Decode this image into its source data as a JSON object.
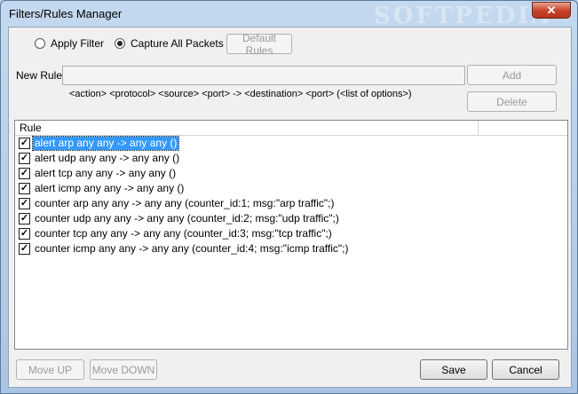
{
  "window": {
    "title": "Filters/Rules Manager",
    "close_glyph": "✕",
    "watermark": "SOFTPEDIA"
  },
  "mode": {
    "apply_filter_label": "Apply Filter",
    "capture_all_label": "Capture All Packets",
    "selected": "capture_all",
    "default_rules_label": "Default Rules"
  },
  "new_rule": {
    "label": "New Rule",
    "value": "",
    "syntax_hint": "<action> <protocol> <source> <port> -> <destination> <port> (<list of options>)",
    "add_label": "Add",
    "delete_label": "Delete"
  },
  "rules_table": {
    "columns": [
      "Rule",
      ""
    ],
    "rows": [
      {
        "text": "alert arp any any -> any any ()",
        "checked": true,
        "selected": true
      },
      {
        "text": "alert udp any any -> any any ()",
        "checked": true,
        "selected": false
      },
      {
        "text": "alert tcp any any -> any any ()",
        "checked": true,
        "selected": false
      },
      {
        "text": "alert icmp any any -> any any ()",
        "checked": true,
        "selected": false
      },
      {
        "text": "counter arp any any -> any any (counter_id:1; msg:\"arp traffic\";)",
        "checked": true,
        "selected": false
      },
      {
        "text": "counter udp any any -> any any (counter_id:2; msg:\"udp traffic\";)",
        "checked": true,
        "selected": false
      },
      {
        "text": "counter tcp any any -> any any (counter_id:3; msg:\"tcp traffic\";)",
        "checked": true,
        "selected": false
      },
      {
        "text": "counter icmp any any -> any any (counter_id:4; msg:\"icmp traffic\";)",
        "checked": true,
        "selected": false
      }
    ]
  },
  "footer": {
    "move_up_label": "Move UP",
    "move_down_label": "Move DOWN",
    "save_label": "Save",
    "cancel_label": "Cancel"
  },
  "colors": {
    "selection": "#3399ff",
    "frame": "#b9d1ea",
    "close": "#c8452c"
  }
}
